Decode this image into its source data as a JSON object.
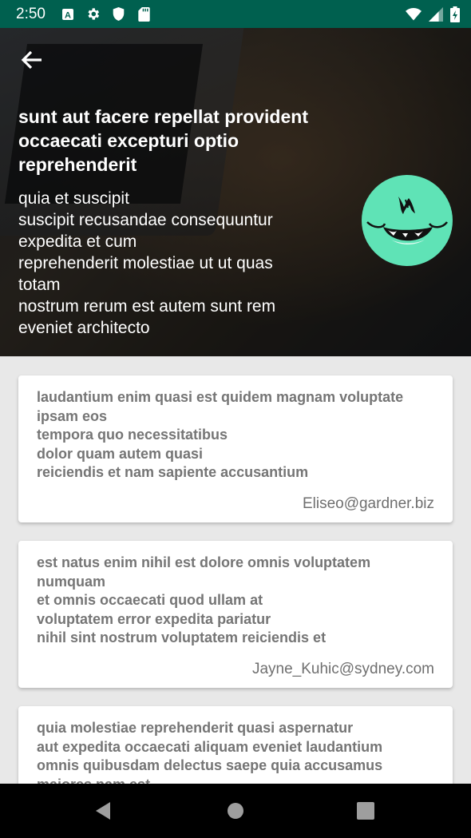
{
  "status_bar": {
    "time": "2:50",
    "icons": [
      "a-box-icon",
      "gear-icon",
      "shield-icon",
      "sd-card-icon",
      "wifi-icon",
      "signal-icon",
      "battery-icon"
    ]
  },
  "header": {
    "title_lines": [
      "sunt aut facere repellat provident",
      "occaecati excepturi optio",
      "reprehenderit"
    ],
    "body_lines": [
      "quia et suscipit",
      "suscipit recusandae consequuntur",
      "expedita et cum",
      "reprehenderit molestiae ut ut quas",
      "totam",
      "nostrum rerum est autem sunt rem",
      "eveniet architecto"
    ],
    "avatar_color": "#5fe3b6"
  },
  "cards": [
    {
      "lines": [
        "laudantium enim quasi est quidem magnam voluptate",
        "ipsam eos",
        "tempora quo necessitatibus",
        "dolor quam autem quasi",
        "reiciendis et nam sapiente accusantium"
      ],
      "email": "Eliseo@gardner.biz"
    },
    {
      "lines": [
        "est natus enim nihil est dolore omnis voluptatem",
        "numquam",
        "et omnis occaecati quod ullam at",
        "voluptatem error expedita pariatur",
        "nihil sint nostrum voluptatem reiciendis et"
      ],
      "email": "Jayne_Kuhic@sydney.com"
    },
    {
      "lines": [
        "quia molestiae reprehenderit quasi aspernatur",
        "aut expedita occaecati aliquam eveniet laudantium",
        "omnis quibusdam delectus saepe quia accusamus",
        "maiores nam est"
      ],
      "email": ""
    }
  ],
  "colors": {
    "status_bar": "#00604f",
    "background": "#e8e8e8",
    "card_text": "#757575"
  }
}
